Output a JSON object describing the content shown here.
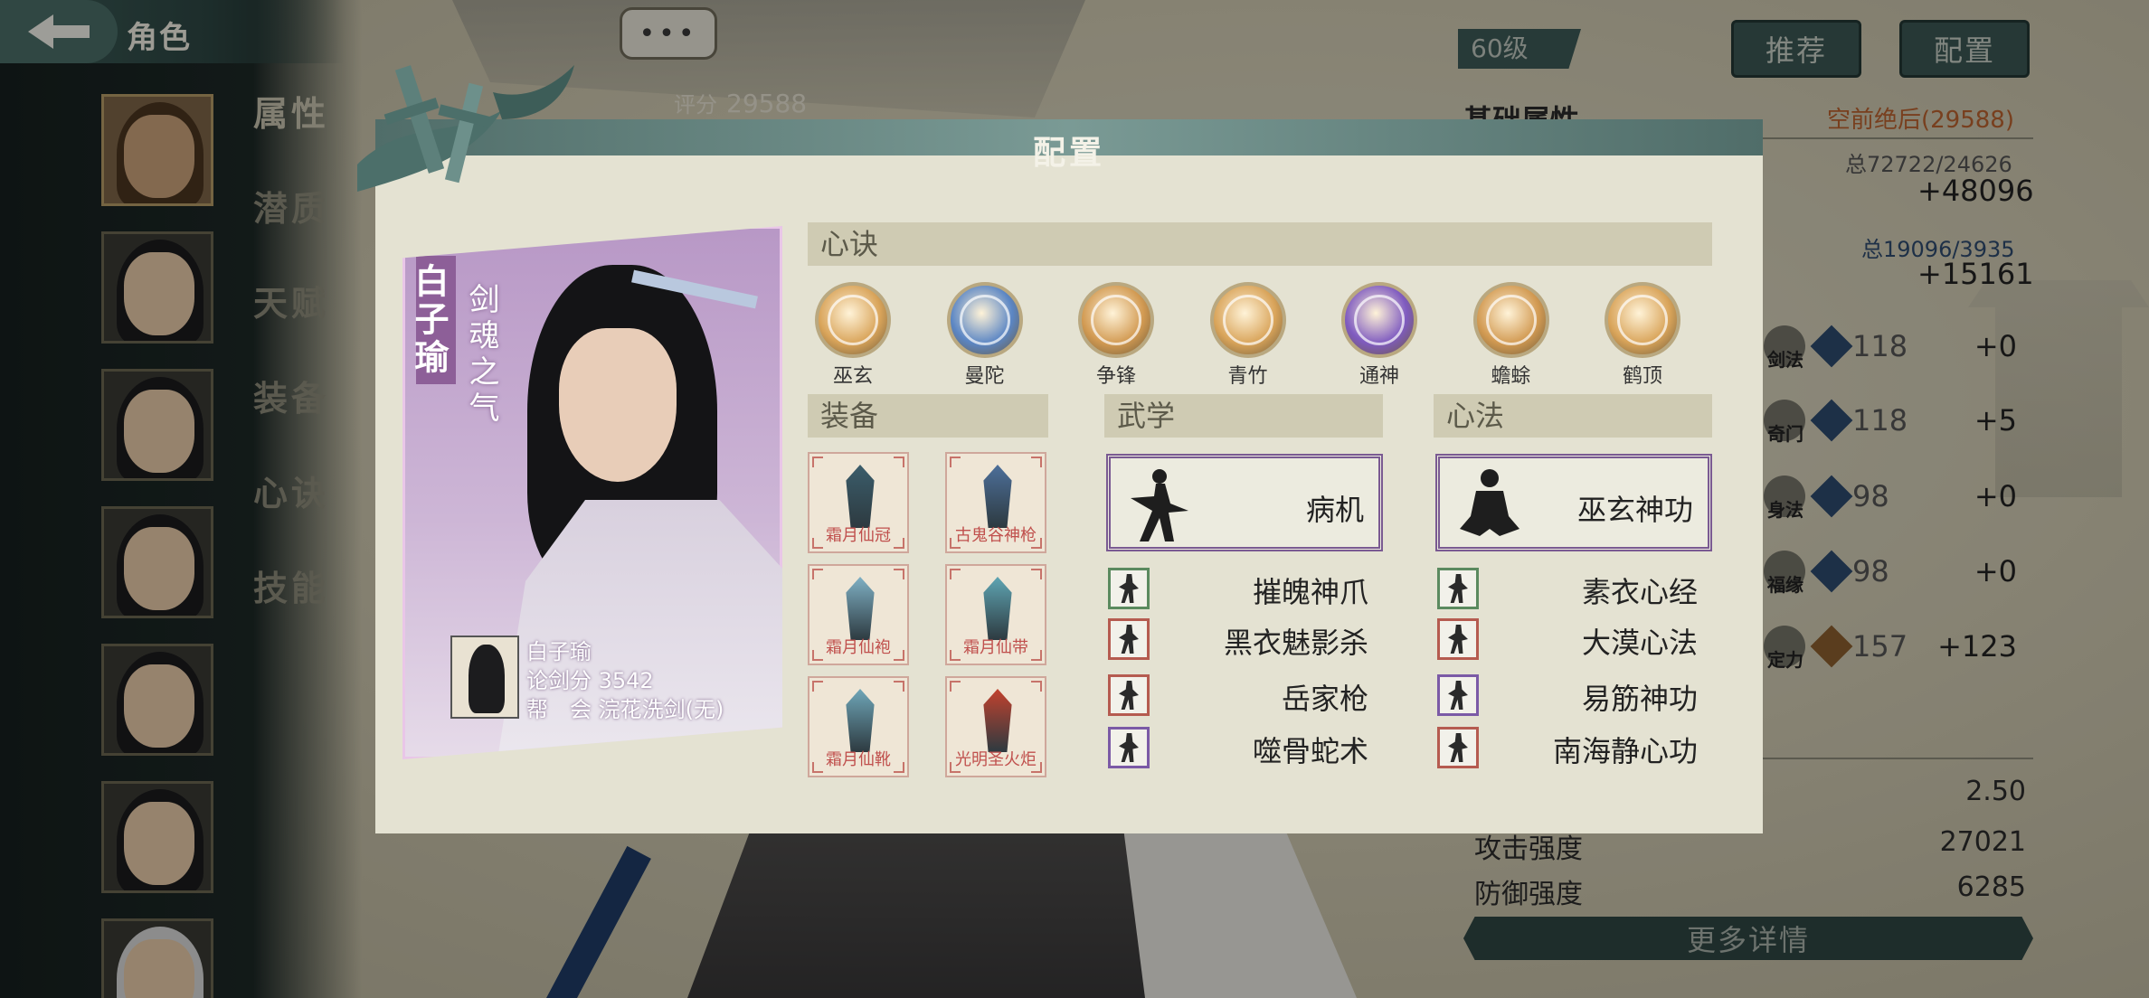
{
  "topbar": {
    "title": "角色"
  },
  "side_menu": [
    "属性",
    "潜质",
    "天赋",
    "装备",
    "心诀",
    "技能"
  ],
  "chat": {
    "label": "•••"
  },
  "score": {
    "label": "评分",
    "value": "29588"
  },
  "right_panel": {
    "level": "60级",
    "recommend_btn": "推荐",
    "config_btn": "配置",
    "title": "基础属性",
    "rank": "空前绝后(29588)",
    "total1": "总72722/24626",
    "plus1": "+48096",
    "total2": "总19096/3935",
    "plus2": "+15161",
    "stats": [
      {
        "name": "剑法",
        "value": "118",
        "add": "+0"
      },
      {
        "name": "奇门",
        "value": "118",
        "add": "+5"
      },
      {
        "name": "身法",
        "value": "98",
        "add": "+0"
      },
      {
        "name": "福缘",
        "value": "98",
        "add": "+0"
      },
      {
        "name": "定力",
        "value": "157",
        "add": "+123"
      }
    ],
    "kv": [
      {
        "k": "",
        "v": "2.50"
      },
      {
        "k": "攻击强度",
        "v": "27021"
      },
      {
        "k": "防御强度",
        "v": "6285"
      }
    ],
    "more_btn": "更多详情"
  },
  "modal": {
    "title": "配置",
    "character": {
      "name": "白子瑜",
      "title": "剑魂之气",
      "info_name": "白子瑜",
      "info_score": "论剑分 3542",
      "info_guild": "帮　会 浣花洗剑(无)"
    },
    "xinjue": {
      "header": "心诀",
      "items": [
        {
          "name": "巫玄",
          "color": "#d9a45a"
        },
        {
          "name": "曼陀",
          "color": "#5b86c4"
        },
        {
          "name": "争锋",
          "color": "#d29a52"
        },
        {
          "name": "青竹",
          "color": "#d9a45a"
        },
        {
          "name": "通神",
          "color": "#7f5bc0"
        },
        {
          "name": "蟾蜍",
          "color": "#d29a52"
        },
        {
          "name": "鹤顶",
          "color": "#d9a45a"
        }
      ]
    },
    "equipment": {
      "header": "装备",
      "items": [
        {
          "name": "霜月仙冠",
          "art_color": "#3b5d6b"
        },
        {
          "name": "古鬼谷神枪",
          "art_color": "#4d6f9a"
        },
        {
          "name": "霜月仙袍",
          "art_color": "#7fb0c4"
        },
        {
          "name": "霜月仙带",
          "art_color": "#5fa5b3"
        },
        {
          "name": "霜月仙靴",
          "art_color": "#6fa6b8"
        },
        {
          "name": "光明圣火炬",
          "art_color": "#c2422e"
        }
      ]
    },
    "wuxue": {
      "header": "武学",
      "main": "病机",
      "list": [
        {
          "name": "摧魄神爪",
          "border": "green"
        },
        {
          "name": "黑衣魅影杀",
          "border": "red"
        },
        {
          "name": "岳家枪",
          "border": "red"
        },
        {
          "name": "噬骨蛇术",
          "border": "purple"
        }
      ]
    },
    "xinfa": {
      "header": "心法",
      "main": "巫玄神功",
      "list": [
        {
          "name": "素衣心经",
          "border": "green"
        },
        {
          "name": "大漠心法",
          "border": "red"
        },
        {
          "name": "易筋神功",
          "border": "purple"
        },
        {
          "name": "南海静心功",
          "border": "red"
        }
      ]
    }
  }
}
